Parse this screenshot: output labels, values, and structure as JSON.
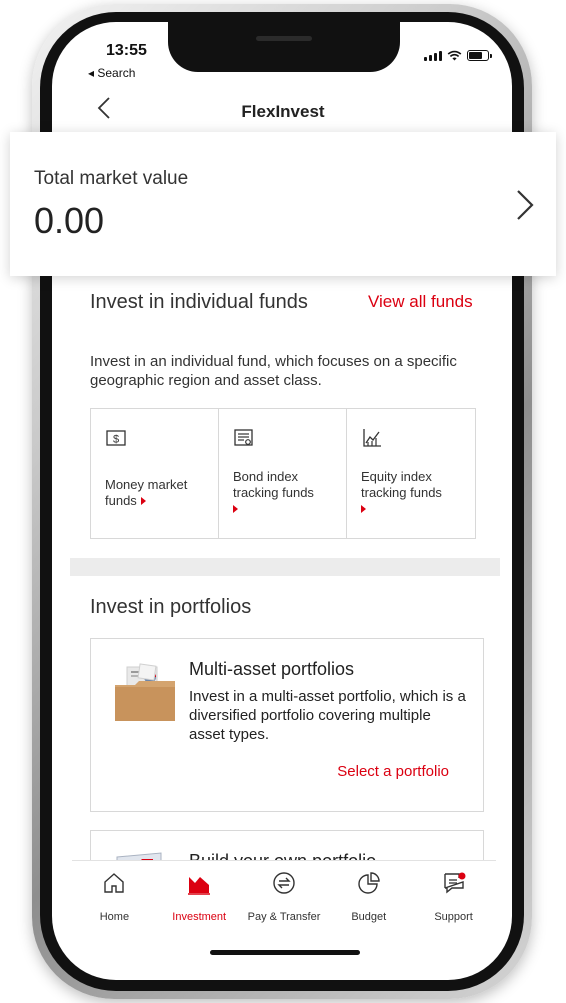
{
  "status_bar": {
    "time": "13:55",
    "back_label": "◂ Search"
  },
  "header": {
    "title": "FlexInvest"
  },
  "market_card": {
    "label": "Total market value",
    "value": "0.00"
  },
  "individual_funds": {
    "heading": "Invest in individual funds",
    "view_all": "View all funds",
    "description": "Invest in an individual fund, which focuses on a specific geographic region and asset class.",
    "tiles": [
      {
        "label": "Money market funds",
        "icon": "dollar-bill-icon"
      },
      {
        "label": "Bond index tracking funds",
        "icon": "bond-document-icon"
      },
      {
        "label": "Equity index tracking funds",
        "icon": "equity-chart-icon"
      }
    ]
  },
  "portfolios": {
    "heading": "Invest in portfolios",
    "multi_asset": {
      "title": "Multi-asset portfolios",
      "description": "Invest in a multi-asset portfolio, which is a diversified portfolio covering multiple asset types.",
      "link": "Select a portfolio"
    },
    "build_own": {
      "title": "Build your own portfolio"
    }
  },
  "tabs": [
    {
      "label": "Home",
      "icon": "home-icon",
      "active": false
    },
    {
      "label": "Investment",
      "icon": "investment-chart-icon",
      "active": true
    },
    {
      "label": "Pay & Transfer",
      "icon": "transfer-icon",
      "active": false
    },
    {
      "label": "Budget",
      "icon": "budget-pie-icon",
      "active": false
    },
    {
      "label": "Support",
      "icon": "support-chat-icon",
      "active": false
    }
  ],
  "colors": {
    "accent": "#db0011",
    "text": "#333333",
    "divider": "#d8d8d8"
  }
}
